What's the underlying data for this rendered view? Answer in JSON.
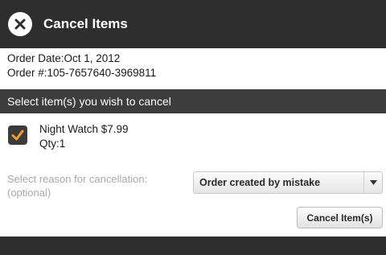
{
  "header": {
    "title": "Cancel Items",
    "close_icon": "close-icon"
  },
  "order": {
    "date_line": "Order Date:Oct 1, 2012",
    "number_line": "Order #:105-7657640-3969811"
  },
  "section": {
    "title": "Select item(s) you wish to cancel"
  },
  "item": {
    "checked": true,
    "name_price": "Night Watch $7.99",
    "qty": "Qty:1"
  },
  "reason": {
    "label_line1": "Select reason for cancellation:",
    "label_line2": "(optional)",
    "selected": "Order created by mistake"
  },
  "actions": {
    "cancel_label": "Cancel Item(s)"
  },
  "colors": {
    "header_bg": "#2e2e2e",
    "section_bg": "#3d3d3d",
    "check_accent": "#f0a030"
  }
}
